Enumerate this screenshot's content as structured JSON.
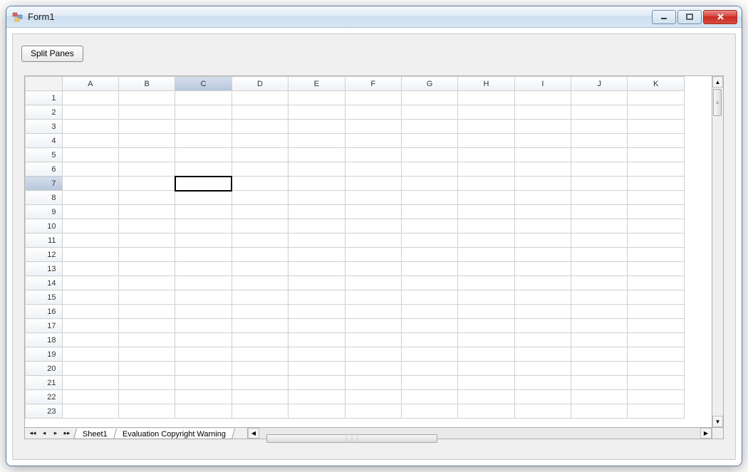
{
  "window": {
    "title": "Form1"
  },
  "toolbar": {
    "split_button_label": "Split Panes"
  },
  "grid": {
    "columns": [
      "A",
      "B",
      "C",
      "D",
      "E",
      "F",
      "G",
      "H",
      "I",
      "J",
      "K"
    ],
    "rows": [
      "1",
      "2",
      "3",
      "4",
      "5",
      "6",
      "7",
      "8",
      "9",
      "10",
      "11",
      "12",
      "13",
      "14",
      "15",
      "16",
      "17",
      "18",
      "19",
      "20",
      "21",
      "22",
      "23"
    ],
    "selected_col_index": 2,
    "selected_row_index": 6
  },
  "tabs": {
    "nav": {
      "first": "◂◂",
      "prev": "◂",
      "next": "▸",
      "last": "▸▸"
    },
    "items": [
      "Sheet1",
      "Evaluation Copyright Warning"
    ],
    "active_index": 0
  }
}
